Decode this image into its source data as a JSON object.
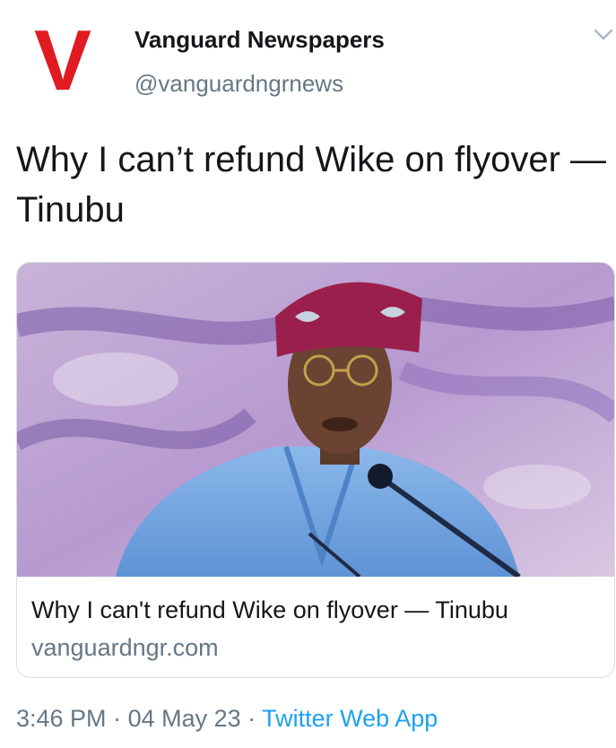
{
  "tweet": {
    "author": {
      "display_name": "Vanguard Newspapers",
      "handle": "@vanguardngrnews",
      "logo_letter": "V"
    },
    "text": "Why I can’t refund Wike on flyover — Tinubu",
    "card": {
      "title": "Why I can't refund Wike on flyover — Tinubu",
      "domain": "vanguardngr.com"
    },
    "meta": {
      "time": "3:46 PM",
      "sep1": " · ",
      "date": "04 May 23",
      "sep2": " · ",
      "source": "Twitter Web App"
    }
  },
  "colors": {
    "brand_red": "#e01b22",
    "link_blue": "#1da1f2",
    "secondary_text": "#657786"
  },
  "icons": {
    "menu": "chevron-down-icon"
  }
}
